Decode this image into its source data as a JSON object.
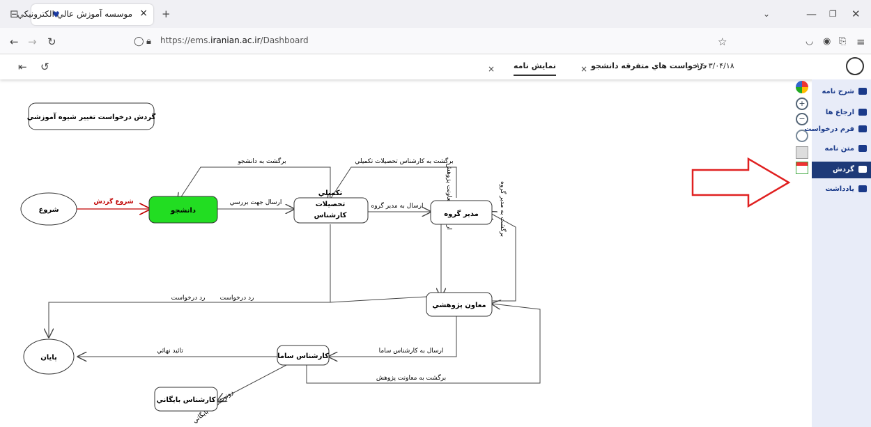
{
  "browser": {
    "tab_title": "موسسه آموزش عالي الكترونيكي",
    "tab_close": "×",
    "new_tab": "+",
    "url_prefix": "https://ems.",
    "url_host": "iranian.ac.ir",
    "url_path": "/Dashboard"
  },
  "doc_tabs": [
    {
      "label": "نمايش نامه",
      "close": "×"
    },
    {
      "label": "درخواست هاي متفرقه دانشجو",
      "close": "×"
    },
    {
      "label": "۱۴۰۳/۰۴/۱۸ ..."
    }
  ],
  "sidebar": {
    "items": [
      {
        "label": "شرح نامه"
      },
      {
        "label": "ارجاع ها"
      },
      {
        "label": "فرم درخواست"
      },
      {
        "label": "متن نامه"
      },
      {
        "label": "گردش"
      },
      {
        "label": "يادداشت"
      }
    ],
    "active_index": 4,
    "active_color": "#1e3a78"
  },
  "flow": {
    "title": "گردش درخواست تغيير شيوه آموزشي",
    "nodes": {
      "start": "شروع",
      "student": "دانشجو",
      "expert": [
        "تكميلي",
        "تحصيلات",
        "كارشناس"
      ],
      "group_manager": "مدير گروه",
      "research_deputy": "معاون پژوهشي",
      "sama_expert": "كارشناس ساما",
      "archive_expert": "كارشناس بايگاني",
      "end": "پايان"
    },
    "edges": {
      "start_flow": "شروع گردش",
      "send_for_review": "ارسال جهت بررسي",
      "return_to_student": "برگشت به دانشجو",
      "return_to_expert": "برگشت به كارشناس تحصيلات تكميلي",
      "send_to_manager": "ارسال به مدير گروه",
      "send_to_deputy": "ارسال به معاونت پژوهش",
      "return_to_manager": "برگشت به مدير گروه",
      "reject_1": "رد درخواست",
      "reject_2": "رد درخواست",
      "send_to_sama": "ارسال به كارشناس ساما",
      "final_approval": "تائيد نهائي",
      "return_to_deputy": "برگشت به معاونت پژوهش",
      "copy_to_archive": "رونوشت به بايگاني"
    },
    "student_color": "#22dd22",
    "start_edge_color": "#c00000",
    "arrow_color": "#e02020"
  }
}
